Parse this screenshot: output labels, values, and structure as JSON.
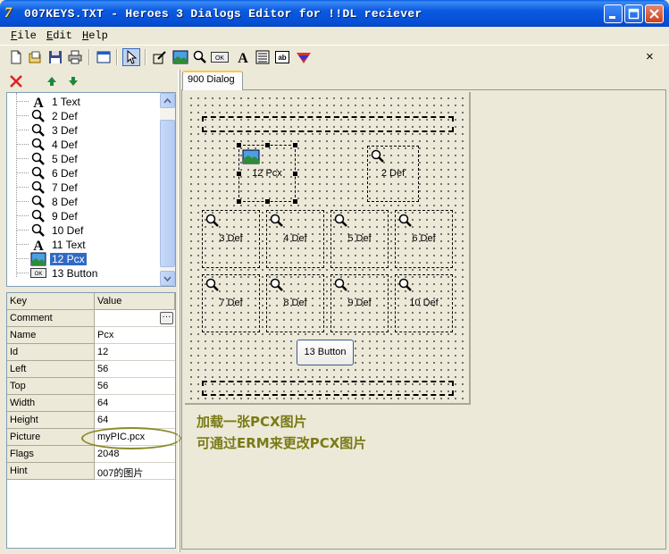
{
  "window": {
    "title": "007KEYS.TXT - Heroes 3 Dialogs Editor for !!DL reciever"
  },
  "menu": {
    "file": "File",
    "edit": "Edit",
    "help": "Help"
  },
  "toolbar": {
    "buttons": [
      "new-icon",
      "open-icon",
      "save-icon",
      "print-icon",
      "window-icon",
      "pointer-icon",
      "edit-icon",
      "picture-icon",
      "magnifier-icon",
      "ok-button-icon",
      "text-icon",
      "list-icon",
      "edit-box-icon",
      "effects-icon"
    ],
    "close_label": "×"
  },
  "tree": {
    "items": [
      {
        "label": "1  Text",
        "icon": "text-icon"
      },
      {
        "label": "2  Def",
        "icon": "magnifier-icon"
      },
      {
        "label": "3  Def",
        "icon": "magnifier-icon"
      },
      {
        "label": "4  Def",
        "icon": "magnifier-icon"
      },
      {
        "label": "5  Def",
        "icon": "magnifier-icon"
      },
      {
        "label": "6  Def",
        "icon": "magnifier-icon"
      },
      {
        "label": "7  Def",
        "icon": "magnifier-icon"
      },
      {
        "label": "8  Def",
        "icon": "magnifier-icon"
      },
      {
        "label": "9  Def",
        "icon": "magnifier-icon"
      },
      {
        "label": "10  Def",
        "icon": "magnifier-icon"
      },
      {
        "label": "11  Text",
        "icon": "text-icon"
      },
      {
        "label": "12  Pcx",
        "icon": "picture-icon",
        "selected": true
      },
      {
        "label": "13  Button",
        "icon": "ok-button-icon"
      }
    ]
  },
  "properties": {
    "header": {
      "key": "Key",
      "value": "Value"
    },
    "rows": [
      {
        "key": "Comment",
        "value": ""
      },
      {
        "key": "Name",
        "value": "Pcx"
      },
      {
        "key": "Id",
        "value": "12"
      },
      {
        "key": "Left",
        "value": "56"
      },
      {
        "key": "Top",
        "value": "56"
      },
      {
        "key": "Width",
        "value": "64"
      },
      {
        "key": "Height",
        "value": "64"
      },
      {
        "key": "Picture",
        "value": "myPIC.pcx"
      },
      {
        "key": "Flags",
        "value": "2048"
      },
      {
        "key": "Hint",
        "value": "007的图片"
      }
    ],
    "ellipsis": "···"
  },
  "tab": {
    "label": "900 Dialog"
  },
  "canvas": {
    "items": {
      "pcx": "12  Pcx",
      "def2": "2  Def",
      "def3": "3  Def",
      "def4": "4  Def",
      "def5": "5  Def",
      "def6": "6  Def",
      "def7": "7  Def",
      "def8": "8  Def",
      "def9": "9  Def",
      "def10": "10  Def",
      "button13": "13  Button"
    }
  },
  "notes": {
    "line1": "加载一张PCX图片",
    "line2": "可通过ERM来更改PCX图片"
  },
  "colors": {
    "selection": "#316ac5",
    "note": "#7a7a16",
    "titlebar": "#0550d6"
  }
}
